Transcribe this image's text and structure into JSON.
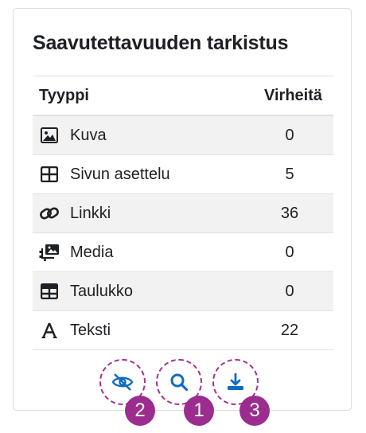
{
  "card": {
    "title": "Saavutettavuuden tarkistus"
  },
  "table": {
    "headers": {
      "type": "Tyyppi",
      "errors": "Virheitä"
    },
    "rows": [
      {
        "icon": "image-icon",
        "label": "Kuva",
        "count": "0"
      },
      {
        "icon": "layout-grid-icon",
        "label": "Sivun asettelu",
        "count": "5"
      },
      {
        "icon": "link-icon",
        "label": "Linkki",
        "count": "36"
      },
      {
        "icon": "media-icon",
        "label": "Media",
        "count": "0"
      },
      {
        "icon": "table-icon",
        "label": "Taulukko",
        "count": "0"
      },
      {
        "icon": "text-icon",
        "label": "Teksti",
        "count": "22"
      }
    ]
  },
  "actions": [
    {
      "icon": "eye-slash-icon",
      "badge": "2"
    },
    {
      "icon": "search-icon",
      "badge": "1"
    },
    {
      "icon": "download-icon",
      "badge": "3"
    }
  ],
  "colors": {
    "accent": "#0f6cbf",
    "highlight": "#9b2d8e",
    "text": "#1d2125"
  }
}
